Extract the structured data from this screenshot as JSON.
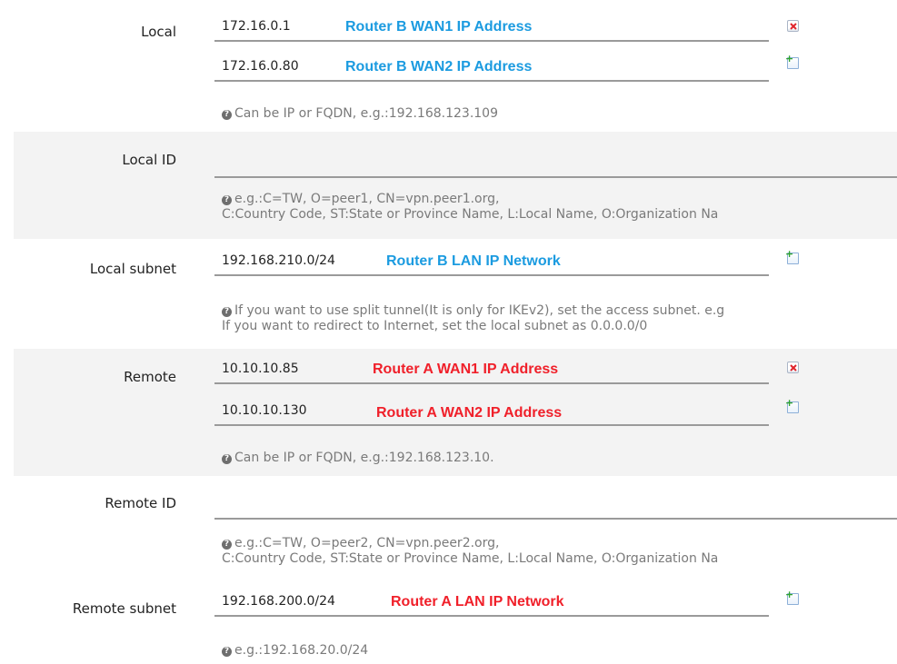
{
  "local": {
    "label": "Local",
    "entries": [
      {
        "value": "172.16.0.1",
        "annotation": "Router B WAN1 IP Address",
        "icon": "delete-icon"
      },
      {
        "value": "172.16.0.80",
        "annotation": "Router B WAN2 IP Address",
        "icon": "add-icon"
      }
    ],
    "help": "Can be IP or FQDN, e.g.:192.168.123.109"
  },
  "local_id": {
    "label": "Local ID",
    "value": "",
    "help_line1": "e.g.:C=TW, O=peer1, CN=vpn.peer1.org,",
    "help_line2": "C:Country Code, ST:State or Province Name, L:Local Name, O:Organization Na"
  },
  "local_subnet": {
    "label": "Local subnet",
    "value": "192.168.210.0/24",
    "annotation": "Router B LAN IP Network",
    "help_line1": "If you want to use split tunnel(It is only for IKEv2), set the access subnet. e.g",
    "help_line2": "If you want to redirect to Internet, set the local subnet as 0.0.0.0/0"
  },
  "remote": {
    "label": "Remote",
    "entries": [
      {
        "value": "10.10.10.85",
        "annotation": "Router A WAN1 IP Address",
        "icon": "delete-icon"
      },
      {
        "value": "10.10.10.130",
        "annotation": "Router A WAN2 IP Address",
        "icon": "add-icon"
      }
    ],
    "help": "Can be IP or FQDN, e.g.:192.168.123.10."
  },
  "remote_id": {
    "label": "Remote ID",
    "value": "",
    "help_line1": "e.g.:C=TW, O=peer2, CN=vpn.peer2.org,",
    "help_line2": "C:Country Code, ST:State or Province Name, L:Local Name, O:Organization Na"
  },
  "remote_subnet": {
    "label": "Remote subnet",
    "value": "192.168.200.0/24",
    "annotation": "Router A LAN IP Network",
    "help": "e.g.:192.168.20.0/24"
  },
  "colors": {
    "router_b_annotation": "#1b9be0",
    "router_a_annotation": "#f0202a",
    "alt_row_background": "#f3f3f3"
  }
}
